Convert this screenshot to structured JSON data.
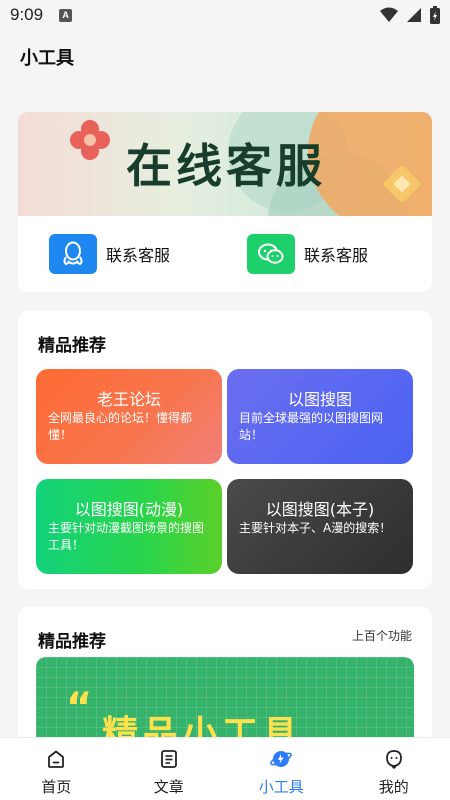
{
  "status_bar": {
    "time": "9:09",
    "badge": "A"
  },
  "header": {
    "title": "小工具"
  },
  "service": {
    "banner_title": "在线客服",
    "contacts": [
      {
        "label": "联系客服",
        "icon": "qq-icon"
      },
      {
        "label": "联系客服",
        "icon": "wechat-icon"
      }
    ]
  },
  "recommend": {
    "title": "精品推荐",
    "tiles": [
      {
        "title": "老王论坛",
        "desc": "全网最良心的论坛！懂得都懂！"
      },
      {
        "title": "以图搜图",
        "desc": "目前全球最强的以图搜图网站！"
      },
      {
        "title": "以图搜图(动漫)",
        "desc": "主要针对动漫截图场景的搜图工具！"
      },
      {
        "title": "以图搜图(本子)",
        "desc": "主要针对本子、A漫的搜索！"
      }
    ]
  },
  "recommend2": {
    "title": "精品推荐",
    "more": "上百个功能",
    "promo_quote": "“",
    "promo_text": "精品小工具"
  },
  "nav": {
    "items": [
      {
        "label": "首页",
        "icon": "home-icon"
      },
      {
        "label": "文章",
        "icon": "article-icon"
      },
      {
        "label": "小工具",
        "icon": "tools-icon",
        "active": true
      },
      {
        "label": "我的",
        "icon": "profile-icon"
      }
    ]
  },
  "colors": {
    "accent": "#2f7df6",
    "qq": "#1e88f0",
    "wechat": "#1ed06b"
  }
}
